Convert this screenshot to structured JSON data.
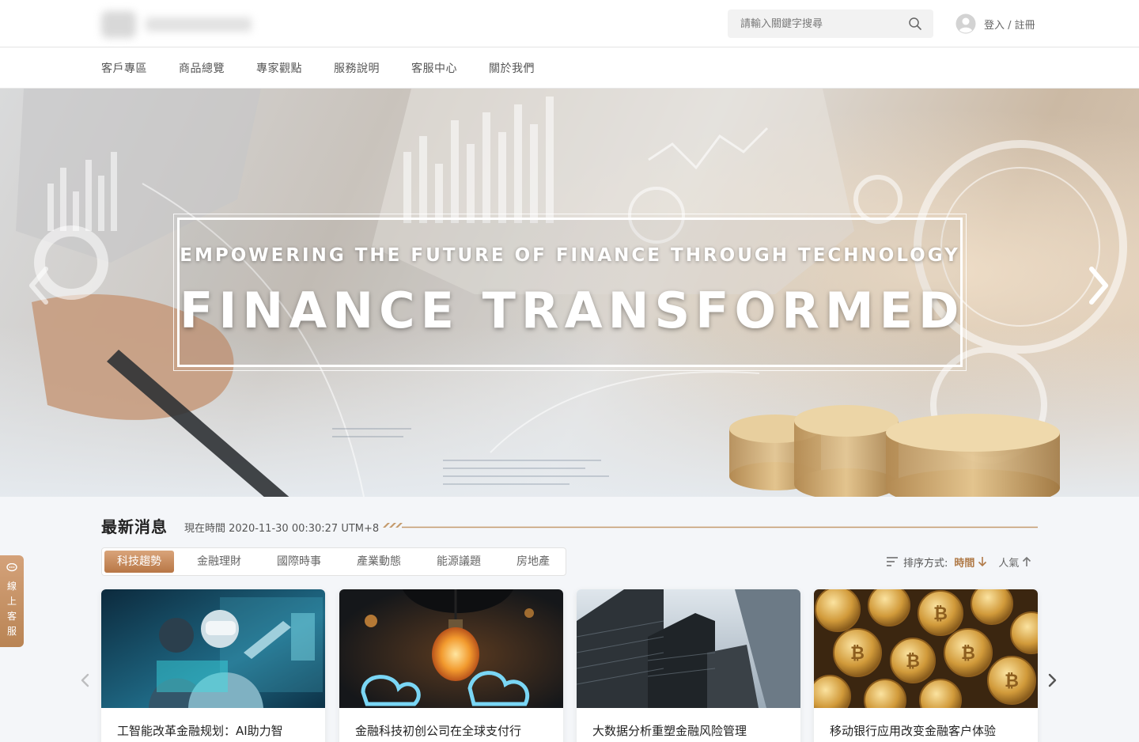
{
  "header": {
    "search_placeholder": "請輸入關鍵字搜尋",
    "login_label": "登入 / 註冊"
  },
  "nav": {
    "items": [
      "客戶專區",
      "商品總覽",
      "專家觀點",
      "服務說明",
      "客服中心",
      "關於我們"
    ]
  },
  "hero": {
    "subtitle": "EMPOWERING THE FUTURE OF FINANCE THROUGH TECHNOLOGY",
    "title": "FINANCE TRANSFORMED"
  },
  "news": {
    "title": "最新消息",
    "time": "現在時間 2020-11-30 00:30:27 UTM+8",
    "tabs": [
      "科技趨勢",
      "金融理財",
      "國際時事",
      "產業動態",
      "能源議題",
      "房地產"
    ],
    "active_tab": "科技趨勢",
    "sort": {
      "label": "排序方式:",
      "options": [
        "時間",
        "人氣"
      ],
      "active": "時間"
    },
    "cards": [
      {
        "title": "工智能改革金融规划：AI助力智",
        "image": "vr-technology-photo"
      },
      {
        "title": "金融科技初创公司在全球支付行",
        "image": "light-bulb-photo"
      },
      {
        "title": "大数据分析重塑金融风险管理",
        "image": "skyscrapers-photo"
      },
      {
        "title": "移动银行应用改变金融客户体验",
        "image": "bitcoin-coins-photo"
      }
    ]
  },
  "chat": {
    "label": "線上客服"
  },
  "colors": {
    "accent": "#b87746",
    "accent_light": "#d9a47a",
    "header_bg": "#ffffff",
    "page_bg": "#f4f6f9"
  }
}
